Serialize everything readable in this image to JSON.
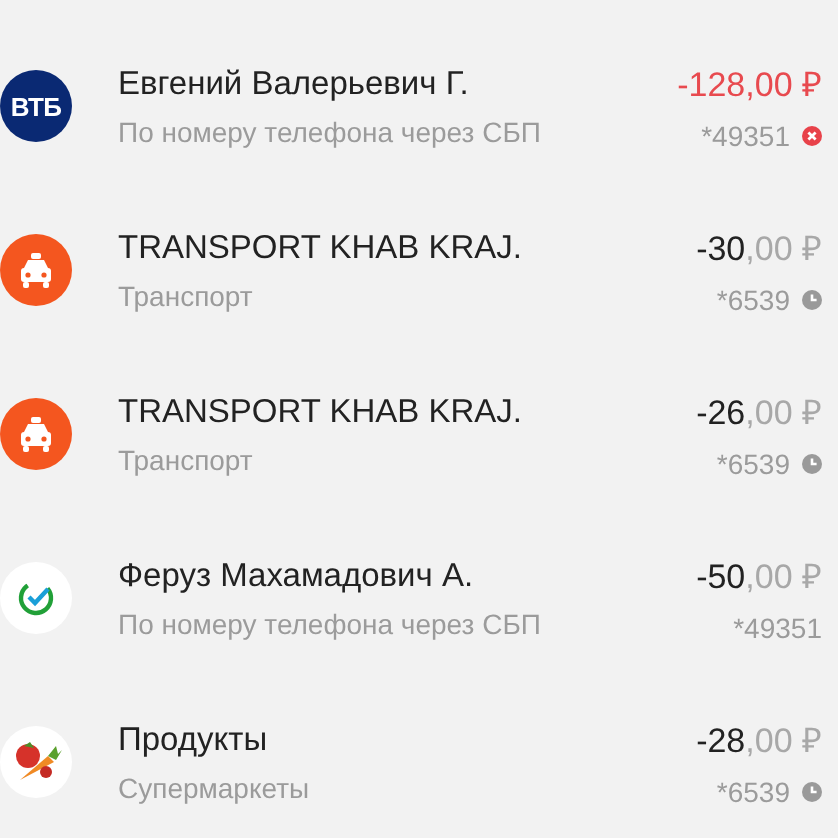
{
  "transactions": [
    {
      "kind": "vtb",
      "logo_text": "ВТБ",
      "name": "Евгений Валерьевич Г.",
      "category": "По номеру телефона через СБП",
      "amount_whole": "-128",
      "amount_fraction": ",00 ₽",
      "card": "*49351",
      "declined": true,
      "pending": false
    },
    {
      "kind": "taxi",
      "name": "TRANSPORT KHAB KRAJ.",
      "category": "Транспорт",
      "amount_whole": "-30",
      "amount_fraction": ",00 ₽",
      "card": "*6539",
      "declined": false,
      "pending": true
    },
    {
      "kind": "taxi",
      "name": "TRANSPORT KHAB KRAJ.",
      "category": "Транспорт",
      "amount_whole": "-26",
      "amount_fraction": ",00 ₽",
      "card": "*6539",
      "declined": false,
      "pending": true
    },
    {
      "kind": "sber",
      "name": "Феруз Махамадович А.",
      "category": "По номеру телефона через СБП",
      "amount_whole": "-50",
      "amount_fraction": ",00 ₽",
      "card": "*49351",
      "declined": false,
      "pending": false
    },
    {
      "kind": "groceries",
      "name": "Продукты",
      "category": "Супермаркеты",
      "amount_whole": "-28",
      "amount_fraction": ",00 ₽",
      "card": "*6539",
      "declined": false,
      "pending": true
    }
  ]
}
